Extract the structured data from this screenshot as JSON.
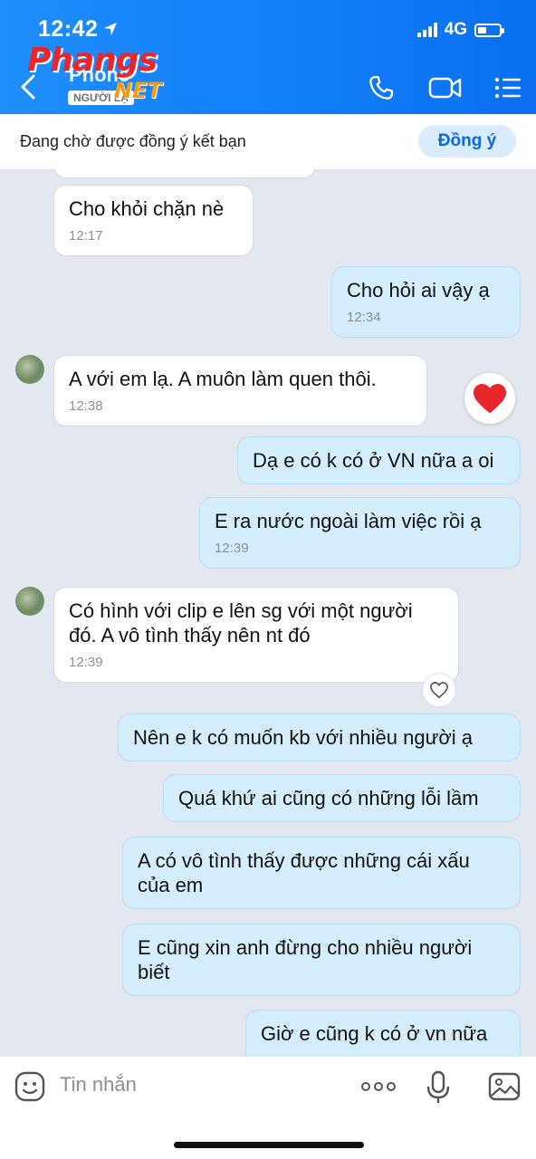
{
  "status_bar": {
    "time": "12:42",
    "network": "4G"
  },
  "header": {
    "contact_name": "Phone",
    "tag": "NGƯỜI LẠ",
    "watermark_main": "Phangs",
    "watermark_net": "NET"
  },
  "friend_request": {
    "text": "Đang chờ được đồng ý kết bạn",
    "accept_label": "Đồng ý"
  },
  "messages": [
    {
      "dir": "in",
      "text": "Cho khỏi chặn nè",
      "time": "12:17"
    },
    {
      "dir": "out",
      "text": "Cho hỏi ai vậy ạ",
      "time": "12:34"
    },
    {
      "dir": "in",
      "text": "A với em lạ. A muôn làm quen thôi.",
      "time": "12:38",
      "reaction": "heart"
    },
    {
      "dir": "out",
      "text": "Dạ e có k có ở VN nữa a oi"
    },
    {
      "dir": "out",
      "text": "E ra nước ngoài làm việc rồi ạ",
      "time": "12:39"
    },
    {
      "dir": "in",
      "text": "Có hình với clip e lên sg với một người đó. A vô tình thấy nên nt đó",
      "time": "12:39"
    },
    {
      "dir": "out",
      "text": "Nên e k có muốn kb với nhiều người ạ"
    },
    {
      "dir": "out",
      "text": "Quá khứ ai cũng có những lỗi lầm"
    },
    {
      "dir": "out",
      "text": "A có vô tình thấy được những cái xấu của em"
    },
    {
      "dir": "out",
      "text": "E cũng xin anh đừng cho nhiều người biết"
    },
    {
      "dir": "out",
      "text": "Giờ e cũng k có ở vn nữa"
    }
  ],
  "input": {
    "placeholder": "Tin nhắn"
  },
  "colors": {
    "header_blue": "#0a6ff0",
    "bubble_out": "#d4eefd",
    "accent": "#0a68e8",
    "heart": "#e8262c"
  }
}
